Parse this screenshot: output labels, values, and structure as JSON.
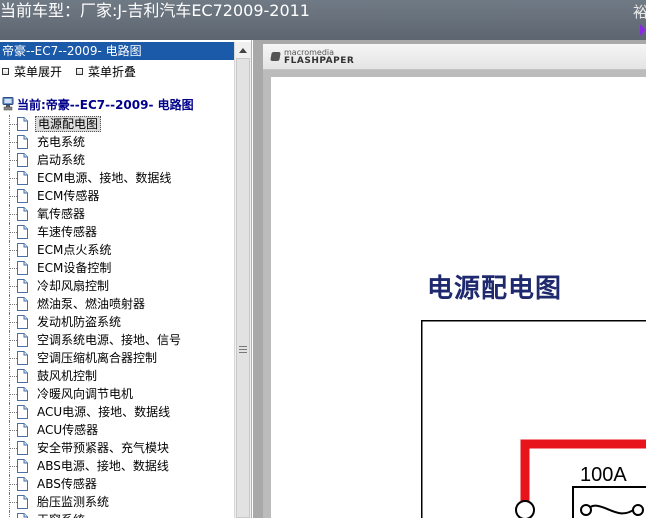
{
  "window": {
    "title": "当前车型：厂家:J-吉利汽车EC72009-2011",
    "corner_glyph": "裕"
  },
  "tree": {
    "header": "帝豪--EC7--2009- 电路图",
    "expand_label": "菜单展开",
    "collapse_label": "菜单折叠",
    "root_label": "当前:帝豪--EC7--2009- 电路图",
    "items": [
      {
        "label": "电源配电图",
        "selected": true
      },
      {
        "label": "充电系统"
      },
      {
        "label": "启动系统"
      },
      {
        "label": "ECM电源、接地、数据线"
      },
      {
        "label": "ECM传感器"
      },
      {
        "label": "氧传感器"
      },
      {
        "label": "车速传感器"
      },
      {
        "label": "ECM点火系统"
      },
      {
        "label": "ECM设备控制"
      },
      {
        "label": "冷却风扇控制"
      },
      {
        "label": "燃油泵、燃油喷射器"
      },
      {
        "label": "发动机防盗系统"
      },
      {
        "label": "空调系统电源、接地、信号"
      },
      {
        "label": "空调压缩机离合器控制"
      },
      {
        "label": "鼓风机控制"
      },
      {
        "label": "冷暖风向调节电机"
      },
      {
        "label": "ACU电源、接地、数据线"
      },
      {
        "label": "ACU传感器"
      },
      {
        "label": "安全带预紧器、充气模块"
      },
      {
        "label": "ABS电源、接地、数据线"
      },
      {
        "label": "ABS传感器"
      },
      {
        "label": "胎压监测系统"
      },
      {
        "label": "天窗系统"
      }
    ]
  },
  "viewer": {
    "logo_small": "macromedia",
    "logo_big": "FLASHPAPER",
    "page_title": "电源配电图",
    "fuse_label": "100A",
    "wire_color": "#e8141c"
  }
}
